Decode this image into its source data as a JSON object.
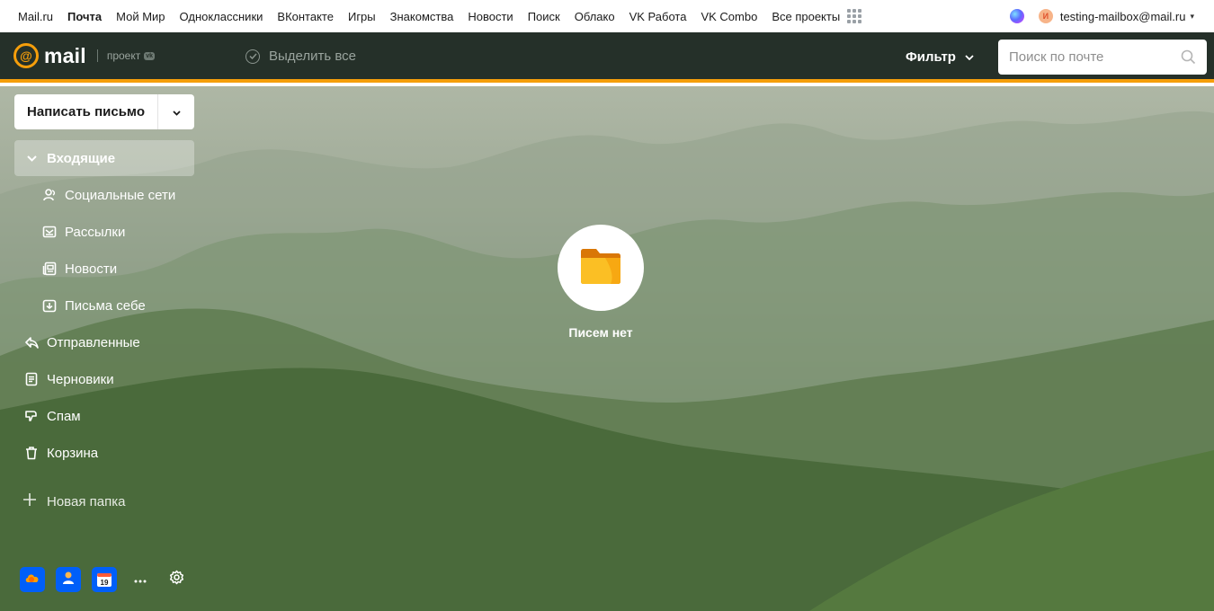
{
  "portal": {
    "links": [
      "Mail.ru",
      "Почта",
      "Мой Мир",
      "Одноклассники",
      "ВКонтакте",
      "Игры",
      "Знакомства",
      "Новости",
      "Поиск",
      "Облако",
      "VK Работа",
      "VK Combo",
      "Все проекты"
    ],
    "active_link": "Почта",
    "user": {
      "avatar_letter": "И",
      "email": "testing-mailbox@mail.ru",
      "caret": "▾"
    }
  },
  "header": {
    "logo": {
      "at": "@",
      "text": "mail",
      "project": "проект",
      "badge": "vk"
    },
    "select_all": "Выделить все",
    "filter": "Фильтр",
    "search": {
      "placeholder": "Поиск по почте"
    }
  },
  "sidebar": {
    "compose_label": "Написать письмо",
    "folders": {
      "inbox": "Входящие",
      "social": "Социальные сети",
      "newsletters": "Рассылки",
      "news": "Новости",
      "to_self": "Письма себе",
      "sent": "Отправленные",
      "drafts": "Черновики",
      "spam": "Спам",
      "trash": "Корзина"
    },
    "new_folder": "Новая папка",
    "calendar_day": "19"
  },
  "main": {
    "empty_label": "Писем нет"
  },
  "colors": {
    "accent": "#f59e0b",
    "header_bg": "#253029",
    "tool_blue": "#005ff9"
  }
}
